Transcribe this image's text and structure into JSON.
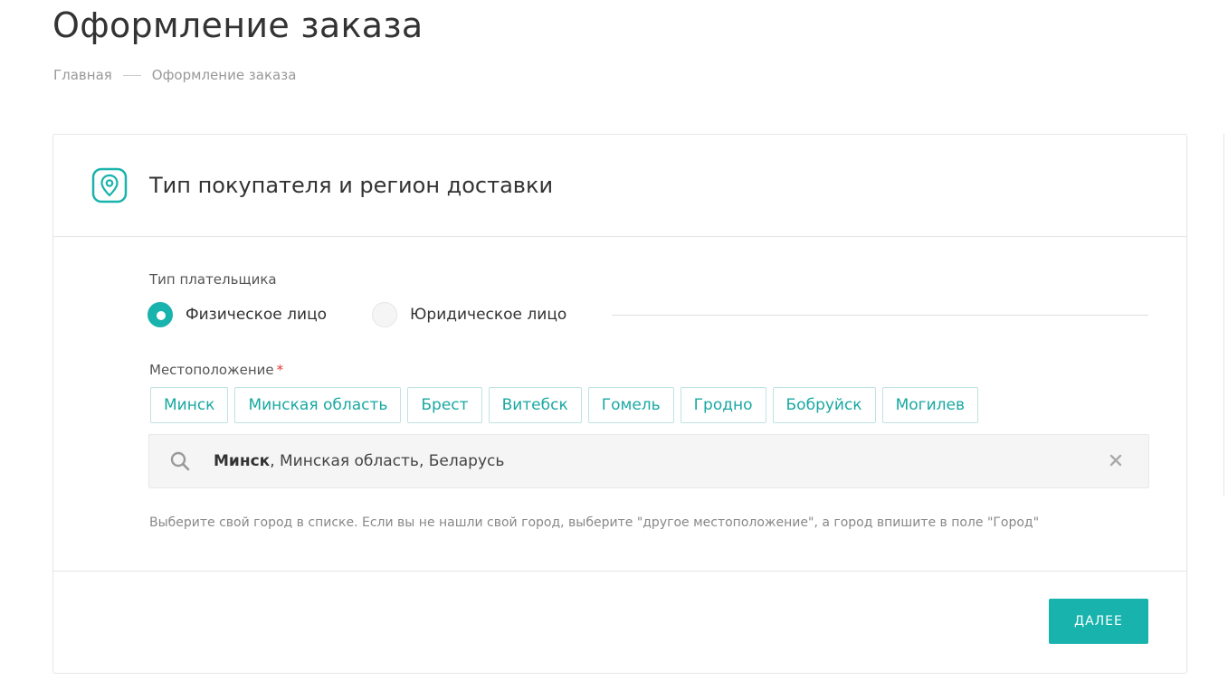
{
  "page": {
    "title": "Оформление заказа"
  },
  "breadcrumb": {
    "home": "Главная",
    "current": "Оформление заказа"
  },
  "section": {
    "icon": "location-pin-icon",
    "title": "Тип покупателя и регион доставки"
  },
  "payer": {
    "label": "Тип плательщика",
    "options": [
      {
        "label": "Физическое лицо",
        "checked": true
      },
      {
        "label": "Юридическое лицо",
        "checked": false
      }
    ]
  },
  "location": {
    "label": "Местоположение",
    "required_mark": "*",
    "chips": [
      "Минск",
      "Минская область",
      "Брест",
      "Витебск",
      "Гомель",
      "Гродно",
      "Бобруйск",
      "Могилев"
    ],
    "value_city": "Минск",
    "value_rest": ", Минская область, Беларусь",
    "hint": "Выберите свой город в списке. Если вы не нашли свой город, выберите \"другое местоположение\", а город впишите в поле \"Город\""
  },
  "actions": {
    "next_label": "ДАЛЕЕ"
  },
  "colors": {
    "accent": "#19b3ad",
    "text": "#333333",
    "muted": "#999999"
  }
}
